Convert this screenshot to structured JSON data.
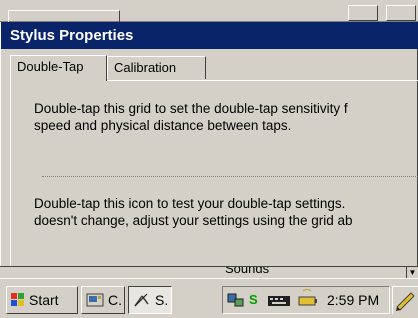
{
  "dialog": {
    "title": "Stylus Properties",
    "tabs": [
      {
        "label": "Double-Tap",
        "active": true
      },
      {
        "label": "Calibration",
        "active": false
      }
    ],
    "paragraph1_line1": "Double-tap this grid to set the double-tap sensitivity f",
    "paragraph1_line2": "speed and physical distance between taps.",
    "paragraph2_line1": "Double-tap this icon to test your double-tap settings.",
    "paragraph2_line2": "doesn't change, adjust your settings using the grid ab"
  },
  "background_list": {
    "visible_text": "Sounds"
  },
  "taskbar": {
    "start_label": "Start",
    "button_c_label": "C.",
    "button_s_label": "S.",
    "tray_s_label": "S",
    "clock": "2:59 PM"
  },
  "colors": {
    "titlebar_bg": "#0a246a",
    "titlebar_fg": "#ffffff",
    "face": "#d4d0c8",
    "tray_s": "#00a000"
  }
}
